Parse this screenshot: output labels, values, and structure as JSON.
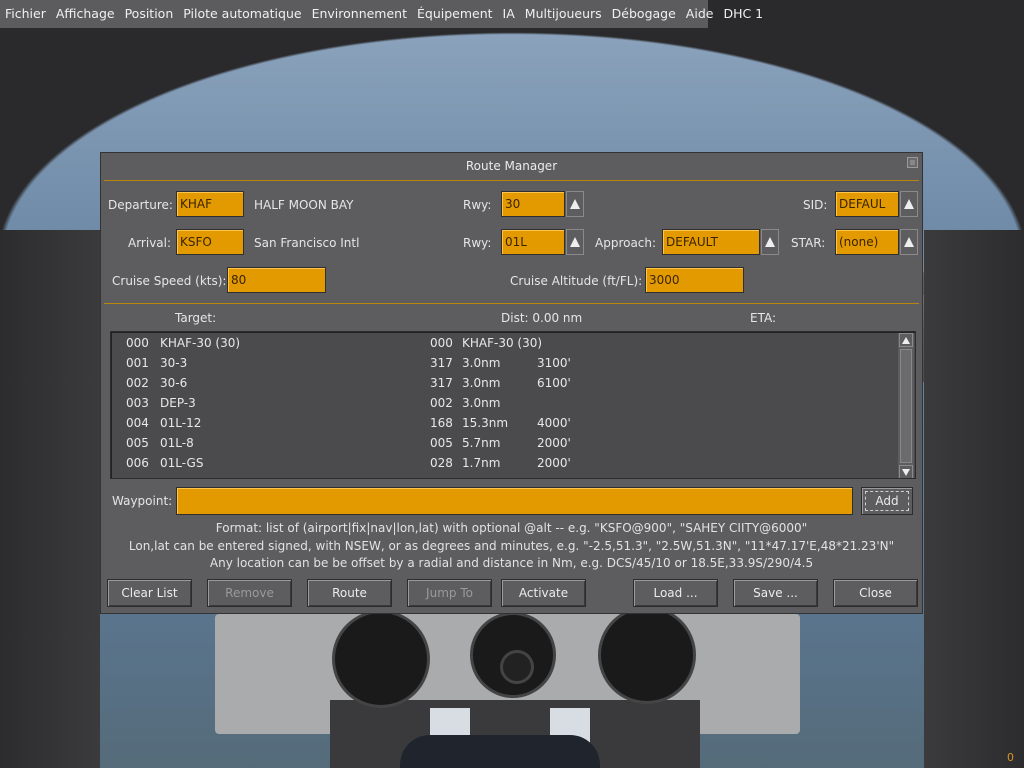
{
  "menubar": {
    "items": [
      "Fichier",
      "Affichage",
      "Position",
      "Pilote automatique",
      "Environnement",
      "Équipement",
      "IA",
      "Multijoueurs",
      "Débogage",
      "Aide",
      "DHC 1"
    ]
  },
  "dialog": {
    "title": "Route Manager",
    "departure": {
      "label": "Departure:",
      "value": "KHAF",
      "name": "HALF MOON BAY",
      "rwy_label": "Rwy:",
      "rwy": "30",
      "sid_label": "SID:",
      "sid": "DEFAUL"
    },
    "arrival": {
      "label": "Arrival:",
      "value": "KSFO",
      "name": "San Francisco Intl",
      "rwy_label": "Rwy:",
      "rwy": "01L",
      "approach_label": "Approach:",
      "approach": "DEFAULT",
      "star_label": "STAR:",
      "star": "(none)"
    },
    "cruise_speed": {
      "label": "Cruise Speed (kts):",
      "value": "80"
    },
    "cruise_altitude": {
      "label": "Cruise Altitude (ft/FL):",
      "value": "3000"
    },
    "list_header": {
      "target": "Target:",
      "dist": "Dist: 0.00 nm",
      "eta": "ETA:"
    },
    "rows": [
      {
        "idx": "000",
        "name": "KHAF-30 (30)",
        "hdg": "000",
        "dist": "KHAF-30 (30)",
        "alt": ""
      },
      {
        "idx": "001",
        "name": "30-3",
        "hdg": "317",
        "dist": "3.0nm",
        "alt": "3100'"
      },
      {
        "idx": "002",
        "name": "30-6",
        "hdg": "317",
        "dist": "3.0nm",
        "alt": "6100'"
      },
      {
        "idx": "003",
        "name": "DEP-3",
        "hdg": "002",
        "dist": "3.0nm",
        "alt": ""
      },
      {
        "idx": "004",
        "name": "01L-12",
        "hdg": "168",
        "dist": "15.3nm",
        "alt": "4000'"
      },
      {
        "idx": "005",
        "name": "01L-8",
        "hdg": "005",
        "dist": "5.7nm",
        "alt": "2000'"
      },
      {
        "idx": "006",
        "name": "01L-GS",
        "hdg": "028",
        "dist": "1.7nm",
        "alt": "2000'"
      }
    ],
    "waypoint": {
      "label": "Waypoint:",
      "value": "",
      "add_label": "Add"
    },
    "help": [
      "Format: list of (airport|fix|nav|lon,lat) with optional @alt -- e.g. \"KSFO@900\", \"SAHEY CIITY@6000\"",
      "Lon,lat can be entered signed, with NSEW, or as degrees and minutes, e.g. \"-2.5,51.3\", \"2.5W,51.3N\", \"11*47.17'E,48*21.23'N\"",
      "Any location can be be offset by a radial and distance in Nm, e.g. DCS/45/10 or 18.5E,33.9S/290/4.5"
    ],
    "buttons": {
      "clear_list": "Clear List",
      "remove": "Remove",
      "route": "Route",
      "jump_to": "Jump To",
      "activate": "Activate",
      "load": "Load ...",
      "save": "Save ...",
      "close": "Close"
    }
  },
  "corner_counter": "0",
  "colors": {
    "field_bg": "#e39a00",
    "dialog_bg": "#5d5d60",
    "separator": "#b7860b"
  }
}
